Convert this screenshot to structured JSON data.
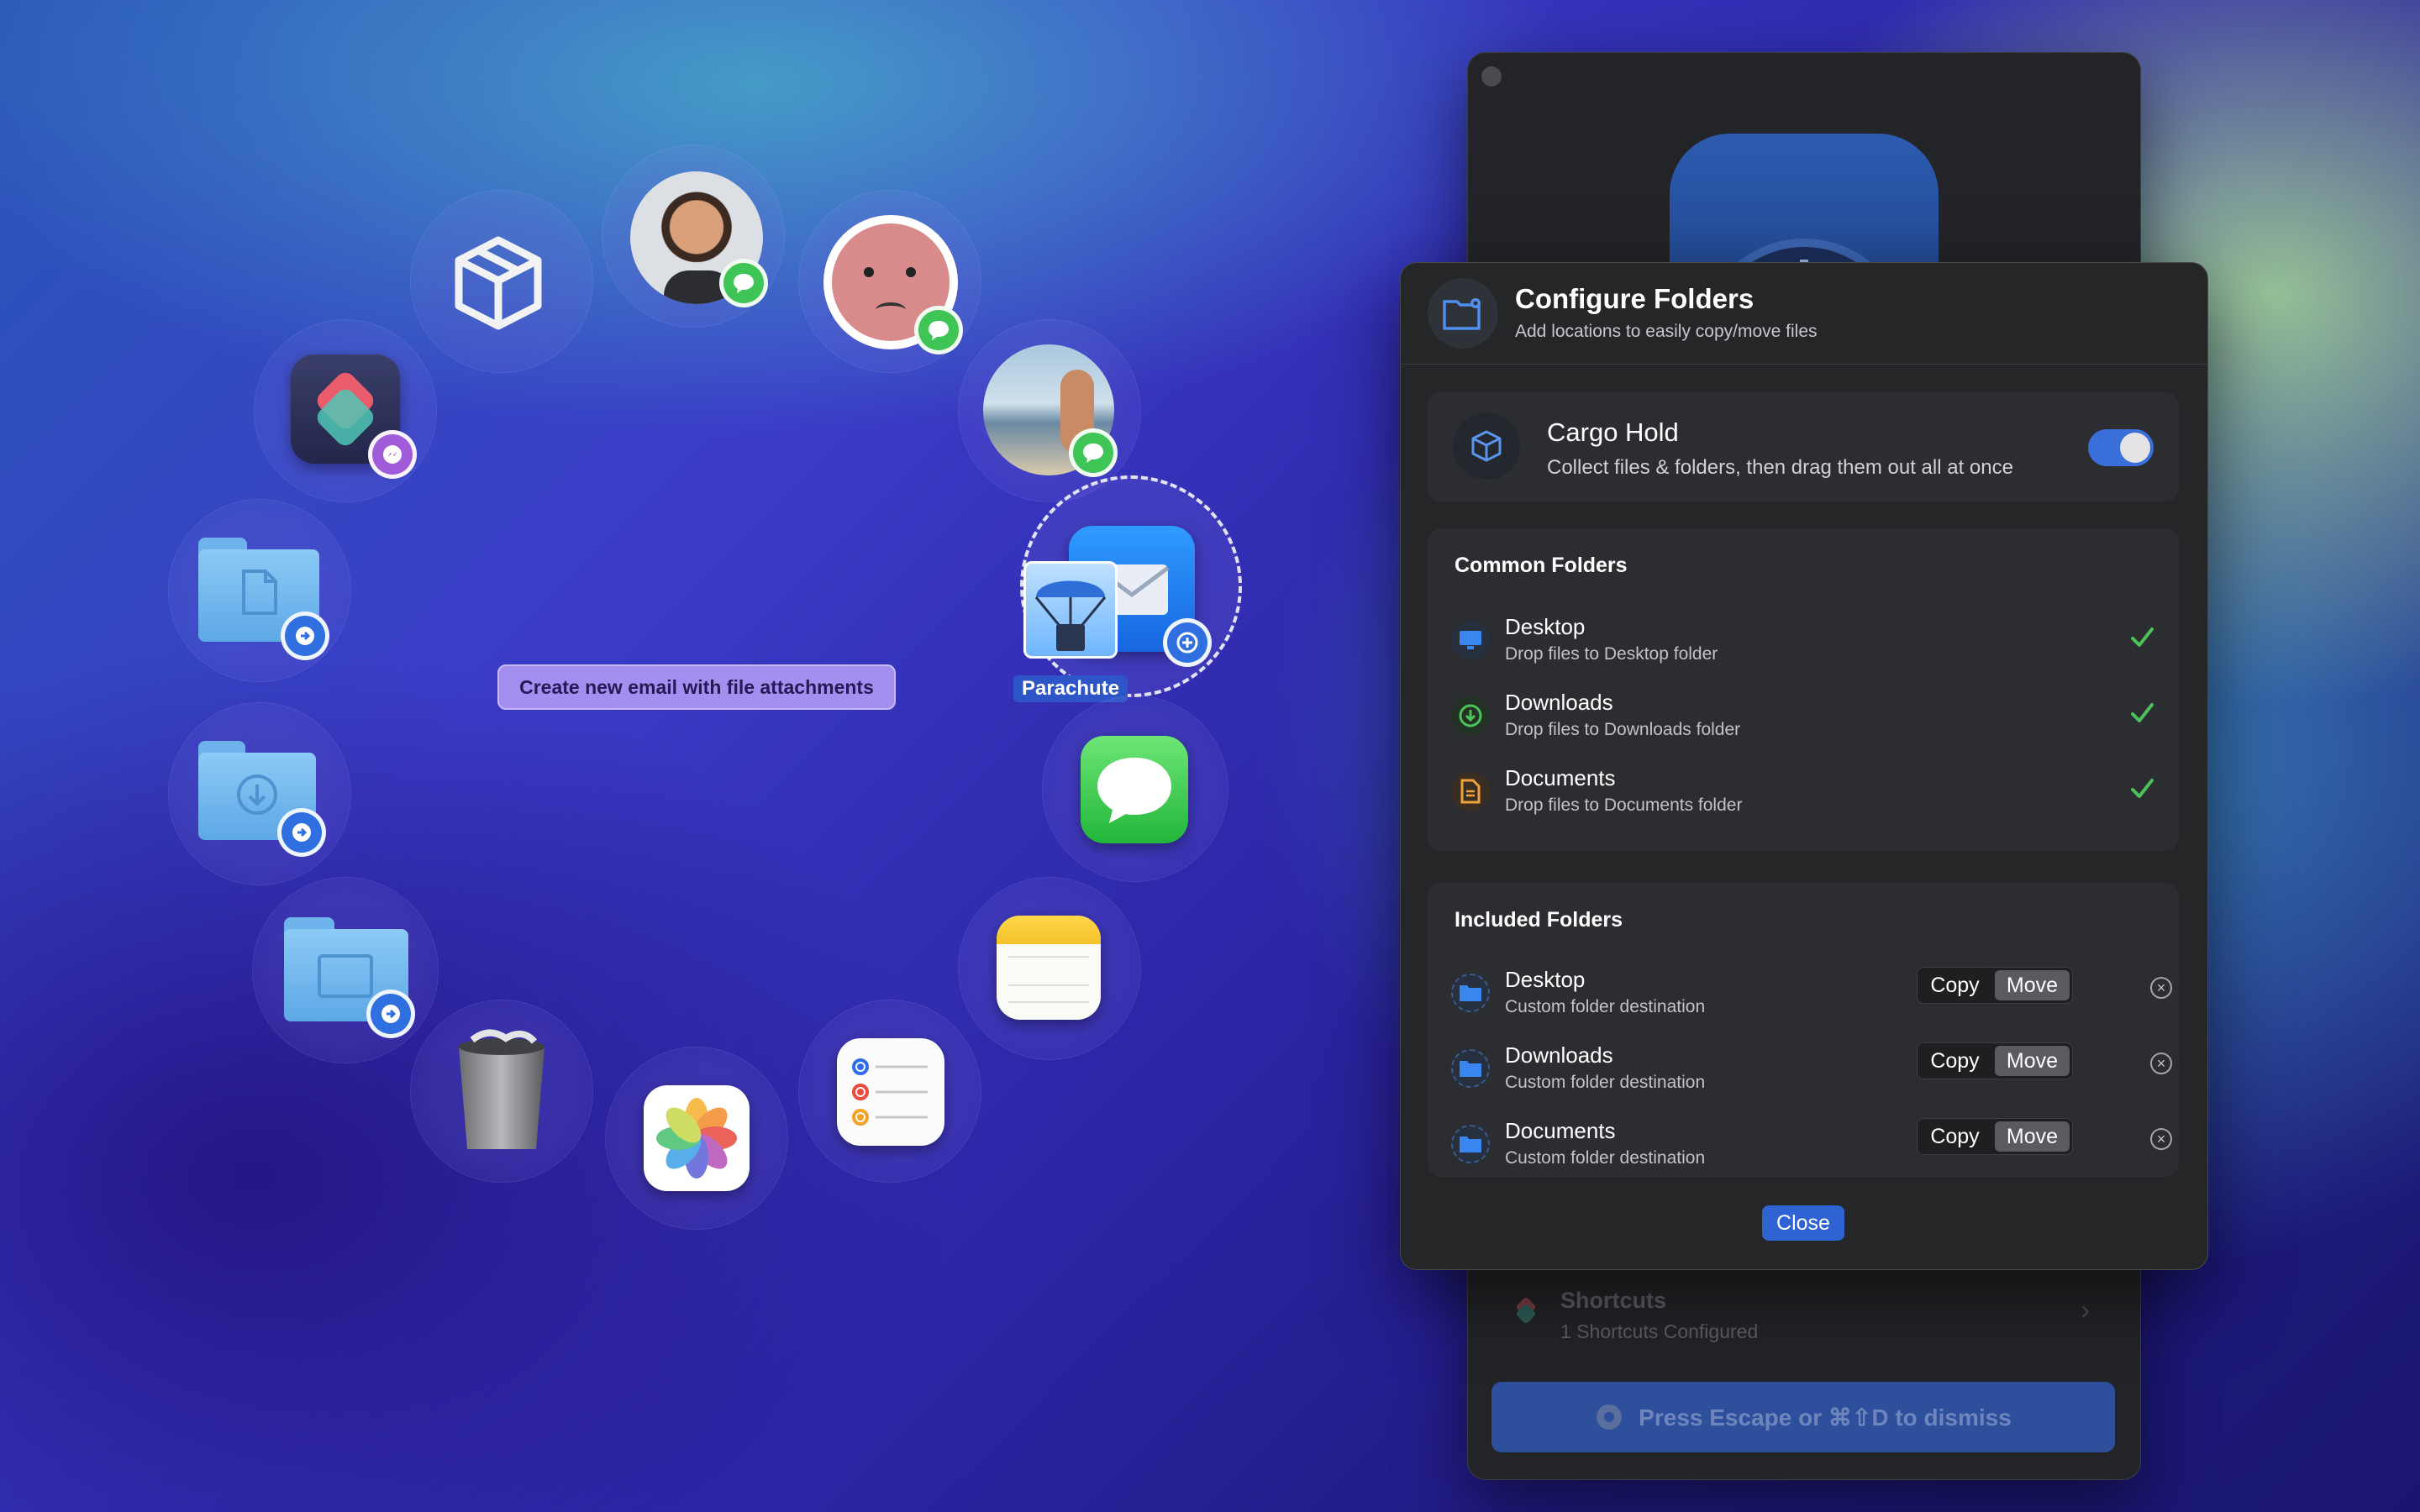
{
  "launcher": {
    "tooltip": "Create new email with file attachments",
    "hovered_label": "Parachute",
    "items": [
      {
        "name": "cargo-box",
        "icon": "box-icon"
      },
      {
        "name": "contact-1",
        "icon": "messages-badge-icon"
      },
      {
        "name": "contact-2",
        "icon": "messages-badge-icon"
      },
      {
        "name": "contact-3",
        "icon": "messages-badge-icon"
      },
      {
        "name": "mail",
        "icon": "mail-icon"
      },
      {
        "name": "messages",
        "icon": "messages-icon"
      },
      {
        "name": "notes",
        "icon": "notes-icon"
      },
      {
        "name": "reminders",
        "icon": "reminders-icon"
      },
      {
        "name": "photos",
        "icon": "photos-icon"
      },
      {
        "name": "trash",
        "icon": "trash-icon"
      },
      {
        "name": "desktop-folder",
        "icon": "folder-icon"
      },
      {
        "name": "downloads-folder",
        "icon": "folder-icon"
      },
      {
        "name": "documents-folder",
        "icon": "folder-icon"
      },
      {
        "name": "shortcuts",
        "icon": "shortcuts-icon"
      }
    ]
  },
  "back_window": {
    "shortcuts_title": "Shortcuts",
    "shortcuts_subtitle": "1 Shortcuts Configured",
    "dismiss_label": "Press Escape or ⌘⇧D to dismiss"
  },
  "panel": {
    "title": "Configure Folders",
    "subtitle": "Add locations to easily copy/move files",
    "cargo": {
      "title": "Cargo Hold",
      "subtitle": "Collect files & folders, then drag them out all at once",
      "enabled": true
    },
    "common": {
      "title": "Common Folders",
      "items": [
        {
          "title": "Desktop",
          "subtitle": "Drop files to Desktop folder",
          "checked": true
        },
        {
          "title": "Downloads",
          "subtitle": "Drop files to Downloads folder",
          "checked": true
        },
        {
          "title": "Documents",
          "subtitle": "Drop files to Documents folder",
          "checked": true
        }
      ]
    },
    "included": {
      "title": "Included Folders",
      "copy_label": "Copy",
      "move_label": "Move",
      "items": [
        {
          "title": "Desktop",
          "subtitle": "Custom folder destination",
          "mode": "Move"
        },
        {
          "title": "Downloads",
          "subtitle": "Custom folder destination",
          "mode": "Move"
        },
        {
          "title": "Documents",
          "subtitle": "Custom folder destination",
          "mode": "Move"
        }
      ]
    },
    "close_label": "Close"
  },
  "colors": {
    "accent": "#2f63d4",
    "check_green": "#4cc15a",
    "tooltip_bg": "#a48ef0"
  }
}
